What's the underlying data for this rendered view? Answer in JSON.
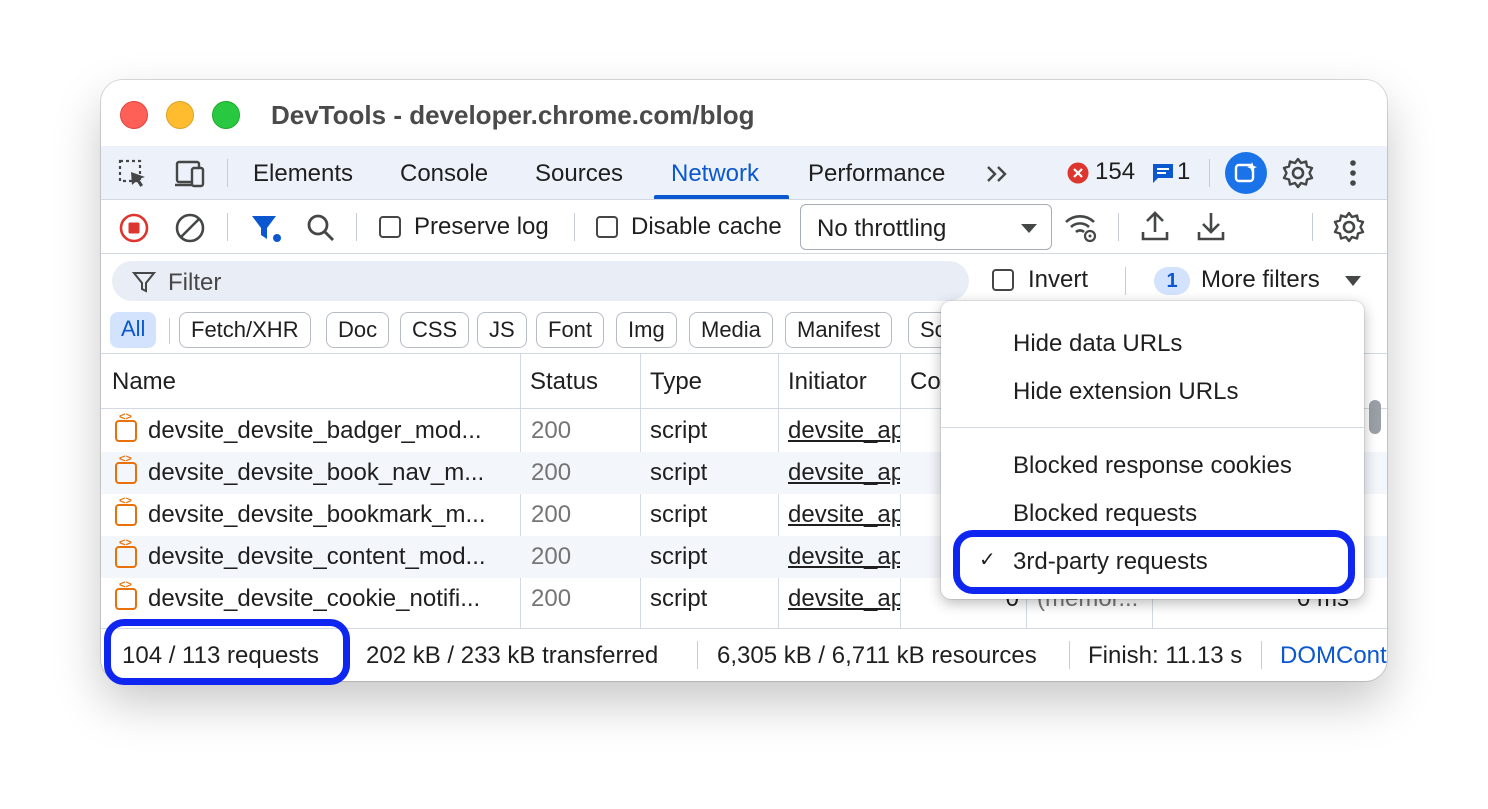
{
  "window": {
    "title": "DevTools - developer.chrome.com/blog"
  },
  "tabs": {
    "items": [
      "Elements",
      "Console",
      "Sources",
      "Network",
      "Performance"
    ],
    "active": "Network",
    "errors_count": "154",
    "messages_count": "1"
  },
  "toolbar": {
    "preserve_log": "Preserve log",
    "disable_cache": "Disable cache",
    "throttling": "No throttling"
  },
  "filter": {
    "placeholder": "Filter",
    "invert": "Invert",
    "more_filters_count": "1",
    "more_filters": "More filters"
  },
  "type_chips": [
    "All",
    "Fetch/XHR",
    "Doc",
    "CSS",
    "JS",
    "Font",
    "Img",
    "Media",
    "Manifest",
    "So"
  ],
  "table": {
    "columns": [
      "Name",
      "Status",
      "Type",
      "Initiator",
      "Co"
    ],
    "rows": [
      {
        "name": "devsite_devsite_badger_mod...",
        "status": "200",
        "type": "script",
        "initiator": "devsite_ap"
      },
      {
        "name": "devsite_devsite_book_nav_m...",
        "status": "200",
        "type": "script",
        "initiator": "devsite_ap"
      },
      {
        "name": "devsite_devsite_bookmark_m...",
        "status": "200",
        "type": "script",
        "initiator": "devsite_ap"
      },
      {
        "name": "devsite_devsite_content_mod...",
        "status": "200",
        "type": "script",
        "initiator": "devsite_ap"
      },
      {
        "name": "devsite_devsite_cookie_notifi...",
        "status": "200",
        "type": "script",
        "initiator": "devsite_ap",
        "size": "0",
        "time": "(memor...",
        "ms": "0 ms"
      }
    ]
  },
  "status_bar": {
    "requests": "104 / 113 requests",
    "transferred": "202 kB / 233 kB transferred",
    "resources": "6,305 kB / 6,711 kB resources",
    "finish": "Finish: 11.13 s",
    "domcontent": "DOMCont"
  },
  "more_filters_menu": {
    "items": [
      "Hide data URLs",
      "Hide extension URLs",
      "Blocked response cookies",
      "Blocked requests",
      "3rd-party requests"
    ],
    "checked": "3rd-party requests"
  },
  "colors": {
    "accent": "#0b57d0",
    "highlight": "#0f26f0",
    "error": "#dc362e",
    "record": "#dc362e",
    "toolbar_bg": "#edf2fa"
  }
}
